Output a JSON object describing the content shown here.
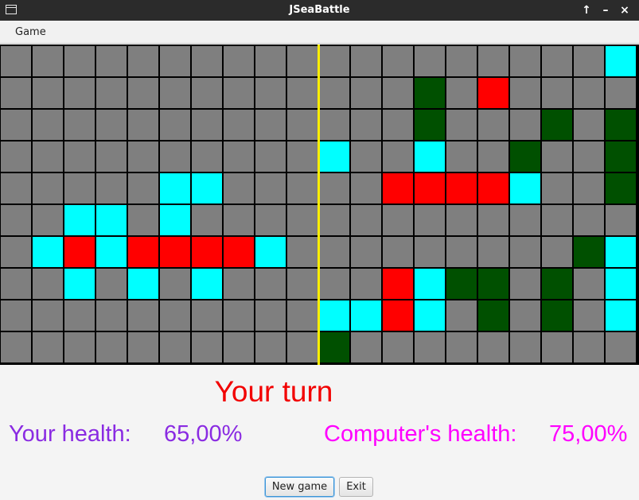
{
  "window": {
    "title": "JSeaBattle"
  },
  "window_controls": {
    "maximize": "↑",
    "minimize": "–",
    "close": "×"
  },
  "menu": {
    "game": "Game"
  },
  "status": {
    "turn": "Your turn"
  },
  "health": {
    "player_label": "Your health:",
    "player_value": "65,00%",
    "computer_label": "Computer's health:",
    "computer_value": "75,00%"
  },
  "buttons": {
    "new_game": "New game",
    "exit": "Exit"
  },
  "colors": {
    "empty": "#7f7f7f",
    "hit": "#ff0000",
    "miss": "#00ffff",
    "ship": "#005000",
    "divider": "#ffee00",
    "grid_line": "#000000",
    "status_text": "#f20000",
    "player_health": "#8a2be2",
    "computer_health": "#ff00ff"
  },
  "boards": {
    "legend": {
      ".": "empty",
      "H": "hit",
      "M": "miss",
      "S": "ship"
    },
    "player": [
      "..........",
      "..........",
      "..........",
      "..........",
      ".....MM...",
      "..MM.M....",
      ".MHMHHHHM.",
      "..M.M.M...",
      "..........",
      ".........."
    ],
    "computer": [
      ".........M",
      "...S.H....",
      "...S...S.S",
      "M..M..S..S",
      "..HHHHM..S",
      "..........",
      "........SM",
      "..HMSS.S.M",
      "MMHM.S.S.M",
      "S.........S"
    ]
  }
}
